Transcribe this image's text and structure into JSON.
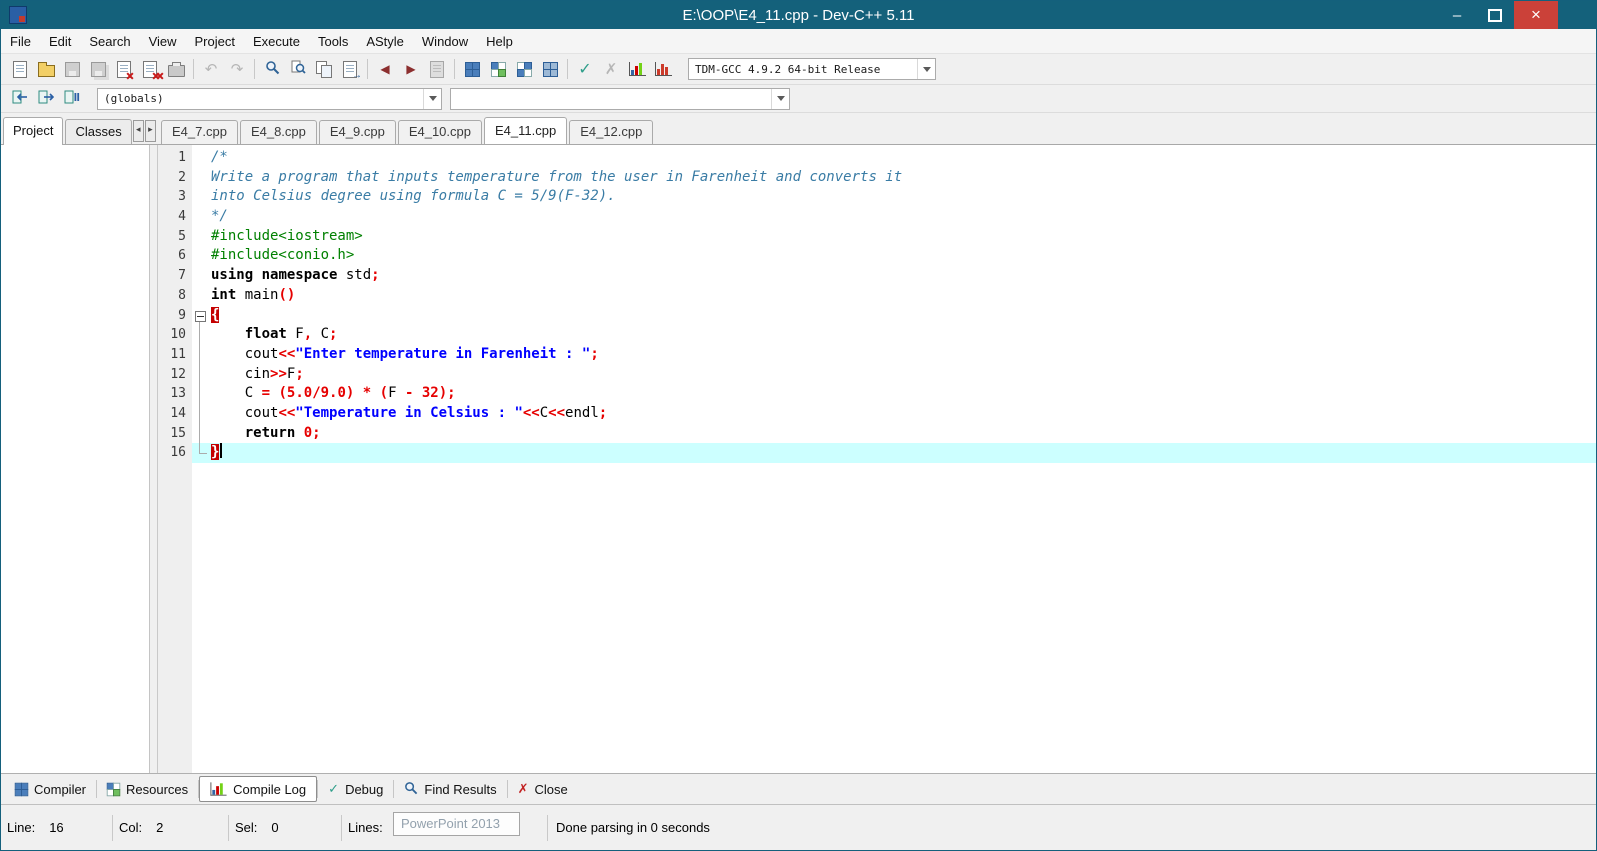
{
  "window": {
    "title": "E:\\OOP\\E4_11.cpp - Dev-C++ 5.11"
  },
  "icons": {
    "minimize": "–",
    "close": "×",
    "undo": "↶",
    "redo": "↷",
    "back": "◀",
    "forward": "▶",
    "check": "✓",
    "cross": "✗",
    "scroll_left": "◂",
    "scroll_right": "▸",
    "arrow_right": "→"
  },
  "menu": {
    "items": [
      "File",
      "Edit",
      "Search",
      "View",
      "Project",
      "Execute",
      "Tools",
      "AStyle",
      "Window",
      "Help"
    ]
  },
  "toolbar": {
    "compiler_profile": "TDM-GCC 4.9.2 64-bit Release"
  },
  "navbar": {
    "globals": "(globals)",
    "members": ""
  },
  "left_panel": {
    "tabs": [
      "Project",
      "Classes"
    ],
    "active_tab": "Project"
  },
  "editor": {
    "tabs": [
      "E4_7.cpp",
      "E4_8.cpp",
      "E4_9.cpp",
      "E4_10.cpp",
      "E4_11.cpp",
      "E4_12.cpp"
    ],
    "active_tab": "E4_11.cpp"
  },
  "code": {
    "language": "cpp",
    "lines": [
      {
        "n": 1,
        "fold": "",
        "hl": false,
        "seg": [
          [
            "cm",
            "/*"
          ]
        ]
      },
      {
        "n": 2,
        "fold": "",
        "hl": false,
        "seg": [
          [
            "cm",
            "Write a program that inputs temperature from the user in Farenheit and converts it"
          ]
        ]
      },
      {
        "n": 3,
        "fold": "",
        "hl": false,
        "seg": [
          [
            "cm",
            "into Celsius degree using formula C = 5/9(F-32)."
          ]
        ]
      },
      {
        "n": 4,
        "fold": "",
        "hl": false,
        "seg": [
          [
            "cm",
            "*/"
          ]
        ]
      },
      {
        "n": 5,
        "fold": "",
        "hl": false,
        "seg": [
          [
            "pp",
            "#include<iostream>"
          ]
        ]
      },
      {
        "n": 6,
        "fold": "",
        "hl": false,
        "seg": [
          [
            "pp",
            "#include<conio.h>"
          ]
        ]
      },
      {
        "n": 7,
        "fold": "",
        "hl": false,
        "seg": [
          [
            "kw",
            "using"
          ],
          [
            "pl",
            " "
          ],
          [
            "kw",
            "namespace"
          ],
          [
            "pl",
            " std"
          ],
          [
            "sym",
            ";"
          ]
        ]
      },
      {
        "n": 8,
        "fold": "",
        "hl": false,
        "seg": [
          [
            "kw",
            "int"
          ],
          [
            "pl",
            " main"
          ],
          [
            "sym",
            "()"
          ]
        ]
      },
      {
        "n": 9,
        "fold": "box",
        "hl": false,
        "seg": [
          [
            "brace",
            "{"
          ]
        ]
      },
      {
        "n": 10,
        "fold": "mid",
        "hl": false,
        "seg": [
          [
            "pl",
            "    "
          ],
          [
            "kw",
            "float"
          ],
          [
            "pl",
            " F"
          ],
          [
            "sym",
            ","
          ],
          [
            "pl",
            " C"
          ],
          [
            "sym",
            ";"
          ]
        ]
      },
      {
        "n": 11,
        "fold": "mid",
        "hl": false,
        "seg": [
          [
            "pl",
            "    cout"
          ],
          [
            "sym",
            "<<"
          ],
          [
            "str",
            "\"Enter temperature in Farenheit : \""
          ],
          [
            "sym",
            ";"
          ]
        ]
      },
      {
        "n": 12,
        "fold": "mid",
        "hl": false,
        "seg": [
          [
            "pl",
            "    cin"
          ],
          [
            "sym",
            ">>"
          ],
          [
            "pl",
            "F"
          ],
          [
            "sym",
            ";"
          ]
        ]
      },
      {
        "n": 13,
        "fold": "mid",
        "hl": false,
        "seg": [
          [
            "pl",
            "    C "
          ],
          [
            "sym",
            "="
          ],
          [
            "pl",
            " "
          ],
          [
            "sym",
            "("
          ],
          [
            "num",
            "5.0"
          ],
          [
            "sym",
            "/"
          ],
          [
            "num",
            "9.0"
          ],
          [
            "sym",
            ")"
          ],
          [
            "pl",
            " "
          ],
          [
            "sym",
            "*"
          ],
          [
            "pl",
            " "
          ],
          [
            "sym",
            "("
          ],
          [
            "pl",
            "F "
          ],
          [
            "sym",
            "-"
          ],
          [
            "pl",
            " "
          ],
          [
            "num",
            "32"
          ],
          [
            "sym",
            ")"
          ],
          [
            "sym",
            ";"
          ]
        ]
      },
      {
        "n": 14,
        "fold": "mid",
        "hl": false,
        "seg": [
          [
            "pl",
            "    cout"
          ],
          [
            "sym",
            "<<"
          ],
          [
            "str",
            "\"Temperature in Celsius : \""
          ],
          [
            "sym",
            "<<"
          ],
          [
            "pl",
            "C"
          ],
          [
            "sym",
            "<<"
          ],
          [
            "pl",
            "endl"
          ],
          [
            "sym",
            ";"
          ]
        ]
      },
      {
        "n": 15,
        "fold": "mid",
        "hl": false,
        "seg": [
          [
            "pl",
            "    "
          ],
          [
            "kw",
            "return"
          ],
          [
            "pl",
            " "
          ],
          [
            "num",
            "0"
          ],
          [
            "sym",
            ";"
          ]
        ]
      },
      {
        "n": 16,
        "fold": "end",
        "hl": true,
        "caret": true,
        "seg": [
          [
            "brace",
            "}"
          ]
        ]
      }
    ]
  },
  "bottom_tabs": [
    {
      "label": "Compiler"
    },
    {
      "label": "Resources"
    },
    {
      "label": "Compile Log"
    },
    {
      "label": "Debug"
    },
    {
      "label": "Find Results"
    },
    {
      "label": "Close"
    }
  ],
  "bottom_active_tab": "Compile Log",
  "status": {
    "line_label": "Line:",
    "line": "16",
    "col_label": "Col:",
    "col": "2",
    "sel_label": "Sel:",
    "sel": "0",
    "lines_label": "Lines:",
    "overlay": "PowerPoint 2013",
    "message": "Done parsing in 0 seconds"
  },
  "colors": {
    "titlebar": "#14617b",
    "close_button": "#cb4139",
    "active_line": "#ccffff",
    "comment": "#3a7ca5",
    "preprocessor": "#008000",
    "string": "#0000ff",
    "symbol": "#e60000",
    "brace_bg": "#c40000"
  }
}
